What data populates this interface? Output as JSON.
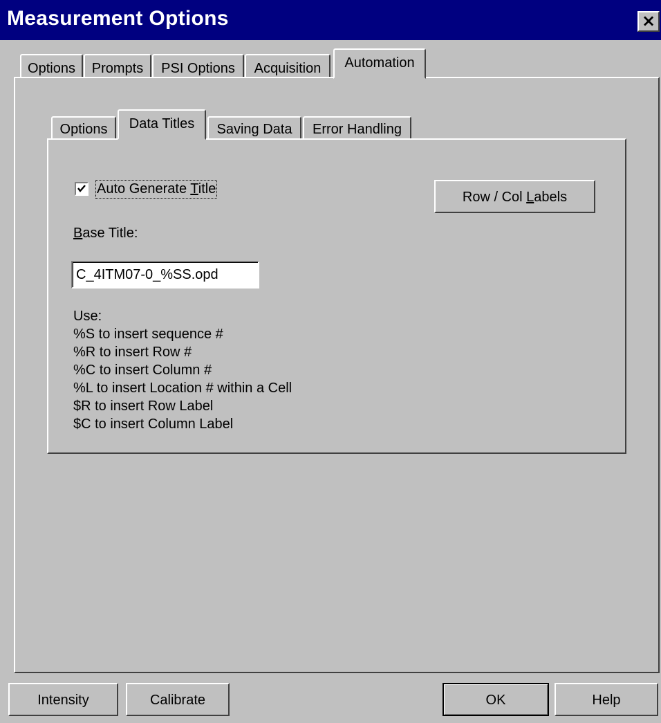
{
  "window": {
    "title": "Measurement Options",
    "close_glyph": "×"
  },
  "outer_tabs": [
    {
      "label": "Options",
      "active": false
    },
    {
      "label": "Prompts",
      "active": false
    },
    {
      "label": "PSI Options",
      "active": false
    },
    {
      "label": "Acquisition",
      "active": false
    },
    {
      "label": "Automation",
      "active": true
    }
  ],
  "inner_tabs": [
    {
      "label": "Options",
      "active": false
    },
    {
      "label": "Data Titles",
      "active": true
    },
    {
      "label": "Saving Data",
      "active": false
    },
    {
      "label": "Error Handling",
      "active": false
    }
  ],
  "data_titles": {
    "auto_generate": {
      "label_pre": "Auto Generate ",
      "label_accel": "T",
      "label_post": "itle",
      "checked": true
    },
    "row_col_button": {
      "label_pre": "Row / Col ",
      "label_accel": "L",
      "label_post": "abels"
    },
    "base_title": {
      "label_accel": "B",
      "label_post": "ase Title:",
      "value": "C_4ITM07-0_%SS.opd"
    },
    "help_lines": [
      "Use:",
      "%S to insert sequence #",
      "%R to insert Row #",
      "%C to insert Column #",
      "%L to insert Location # within a Cell",
      "$R to insert Row Label",
      "$C to insert Column Label"
    ]
  },
  "footer": {
    "intensity": "Intensity",
    "calibrate": "Calibrate",
    "ok": "OK",
    "help": "Help"
  },
  "icons": {
    "close": "close-icon",
    "checkbox": "checkmark-icon"
  }
}
